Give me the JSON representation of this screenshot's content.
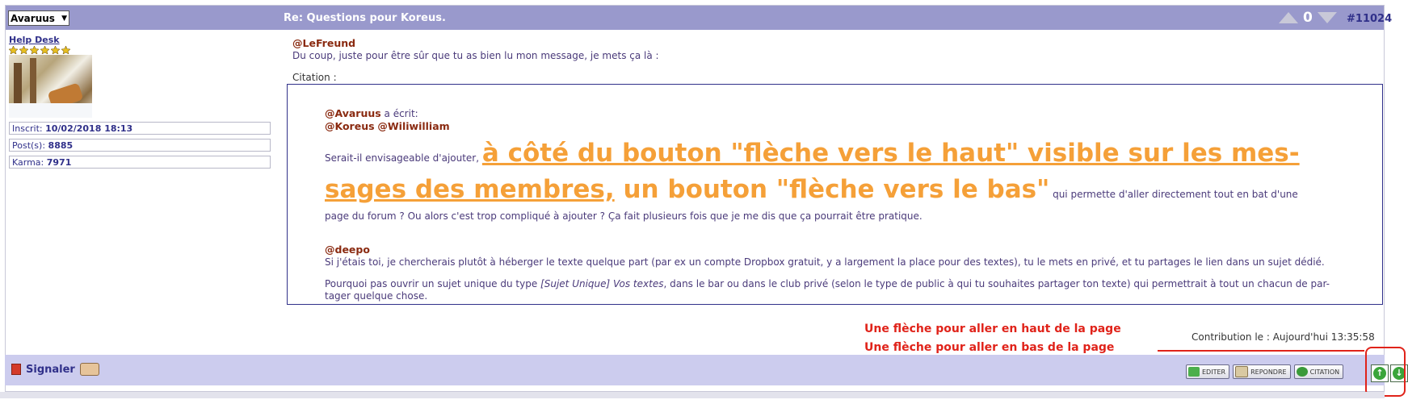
{
  "header": {
    "user_select_value": "Avaruus",
    "title": "Re: Questions pour Koreus.",
    "vote_count": "0",
    "post_number": "#11024"
  },
  "user": {
    "rank": "Help Desk",
    "stars": 6,
    "stats": [
      {
        "label": "Inscrit: ",
        "value": "10/02/2018 18:13"
      },
      {
        "label": "Post(s): ",
        "value": "8885"
      },
      {
        "label": "Karma: ",
        "value": "7971"
      }
    ]
  },
  "message": {
    "mention": "@LeFreund",
    "line1": "Du coup, juste pour être sûr que tu as bien lu mon message, je mets ça là :",
    "citation_label": "Citation :"
  },
  "quote": {
    "author_mention": "@Avaruus",
    "wrote": " a écrit:",
    "to_mention1": "@Koreus",
    "to_mention2": "@Wiliwilliam",
    "lead": "Serait-il envisageable d'ajouter, ",
    "big_underlined_1": "à côté du bouton \"flèche vers le haut\" visible sur les mes-",
    "big_underlined_2": "sages des membres,",
    "big_plain": " un bouton \"flèche vers le bas\"",
    "tail": " qui permette d'aller directement tout en bat d'une",
    "tail2": "page du forum ? Ou alors c'est trop compliqué à ajouter ? Ça fait plusieurs fois que je me dis que ça pourrait être pratique.",
    "deepo_mention": "@deepo",
    "deepo_line": "Si j'étais toi, je chercherais plutôt à héberger le texte quelque part (par ex un compte Dropbox gratuit, y a largement la place pour des textes), tu le mets en privé, et tu partages le lien dans un sujet dédié.",
    "para_start": "Pourquoi pas ouvrir un sujet unique du type ",
    "para_italic": "[Sujet Unique] Vos textes",
    "para_rest": ", dans le bar ou dans le club privé (selon le type de public à qui tu souhaites partager ton texte) qui permettrait à tout un chacun de par-",
    "para_end": "tager quelque chose."
  },
  "contribution": "Contribution le : Aujourd'hui 13:35:58",
  "annotations": {
    "up": "Une flèche pour aller en haut de la page",
    "down": "Une flèche pour aller en bas de la page"
  },
  "footer": {
    "report_label": "Signaler",
    "edit_label": "EDITER",
    "reply_label": "REPONDRE",
    "quote_label": "CITATION"
  },
  "colors": {
    "header_bg": "#9999cc",
    "footer_bg": "#ccccee",
    "highlight_orange": "#f5a038",
    "annotation_red": "#e0231a"
  }
}
